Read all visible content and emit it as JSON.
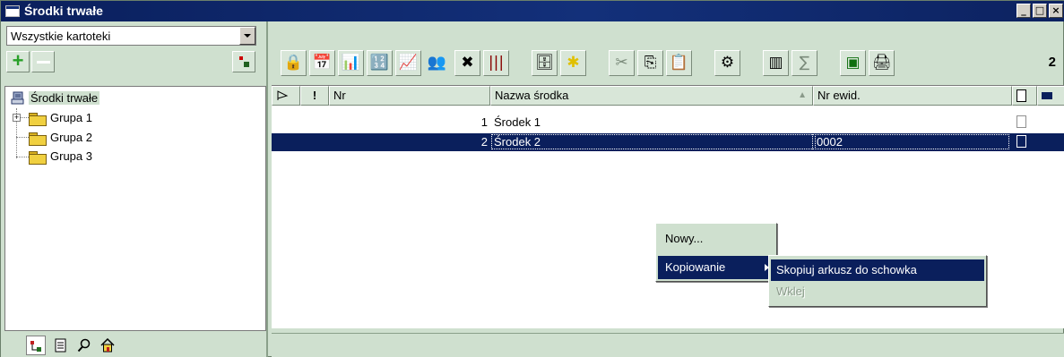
{
  "window": {
    "title": "Środki trwałe",
    "controls": [
      "_",
      "□",
      "×"
    ]
  },
  "sidebar": {
    "filter_value": "Wszystkie kartoteki",
    "add_label": "+",
    "tree": {
      "root": "Środki trwałe",
      "groups": [
        "Grupa 1",
        "Grupa 2",
        "Grupa 3"
      ]
    },
    "bottom_tabs": [
      "tree-view",
      "document",
      "search",
      "home"
    ]
  },
  "toolbar": {
    "record_count": "2",
    "buttons": [
      "lock",
      "calendar",
      "chart",
      "number-table",
      "upload-chart",
      "people",
      "delete",
      "barcode",
      "cabinet",
      "star",
      "cut",
      "copy",
      "paste",
      "properties",
      "columns",
      "sum",
      "excel",
      "print"
    ]
  },
  "table": {
    "headers": {
      "flag": "!",
      "nr": "Nr",
      "name": "Nazwa środka",
      "ewid": "Nr ewid."
    },
    "rows": [
      {
        "nr": "1",
        "name": "Środek 1",
        "ewid": ""
      },
      {
        "nr": "2",
        "name": "Środek 2",
        "ewid": "0002"
      }
    ],
    "selected_row": 2
  },
  "context_menu": {
    "items": [
      "Nowy...",
      "Kopiowanie"
    ],
    "submenu": [
      "Skopiuj arkusz do schowka",
      "Wklej"
    ]
  },
  "colors": {
    "title_bar": "#0a1f5c",
    "background": "#cfe0cf",
    "selection": "#0a1f5c"
  }
}
